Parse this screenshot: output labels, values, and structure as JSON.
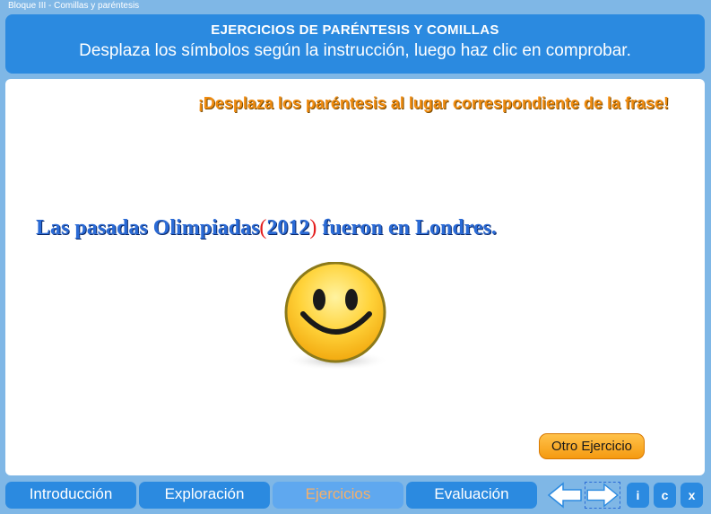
{
  "window": {
    "title": "Bloque III - Comillas y paréntesis"
  },
  "header": {
    "title": "EJERCICIOS DE PARÉNTESIS Y COMILLAS",
    "subtitle": "Desplaza los símbolos según la instrucción, luego haz clic en comprobar."
  },
  "main": {
    "instruction": "¡Desplaza los paréntesis al lugar correspondiente de la frase!",
    "sentence": {
      "before": "Las pasadas Olimpiadas",
      "open_paren": "(",
      "middle": "2012",
      "close_paren": ")",
      "after": " fueron en Londres."
    },
    "feedback_icon": "smiley-face-icon",
    "otro_button": "Otro Ejercicio"
  },
  "nav": {
    "tabs": [
      {
        "label": "Introducción",
        "active": false
      },
      {
        "label": "Exploración",
        "active": false
      },
      {
        "label": "Ejercicios",
        "active": true
      },
      {
        "label": "Evaluación",
        "active": false
      }
    ],
    "info_label": "i",
    "credits_label": "c",
    "close_label": "x"
  },
  "colors": {
    "background": "#7fb7e6",
    "header": "#2b8ae0",
    "instruction": "#f08c10",
    "sentence": "#2b6bd6",
    "parentheses": "#e41c1c",
    "button_orange": "#f59a10",
    "active_tab_text": "#f5b06a"
  }
}
